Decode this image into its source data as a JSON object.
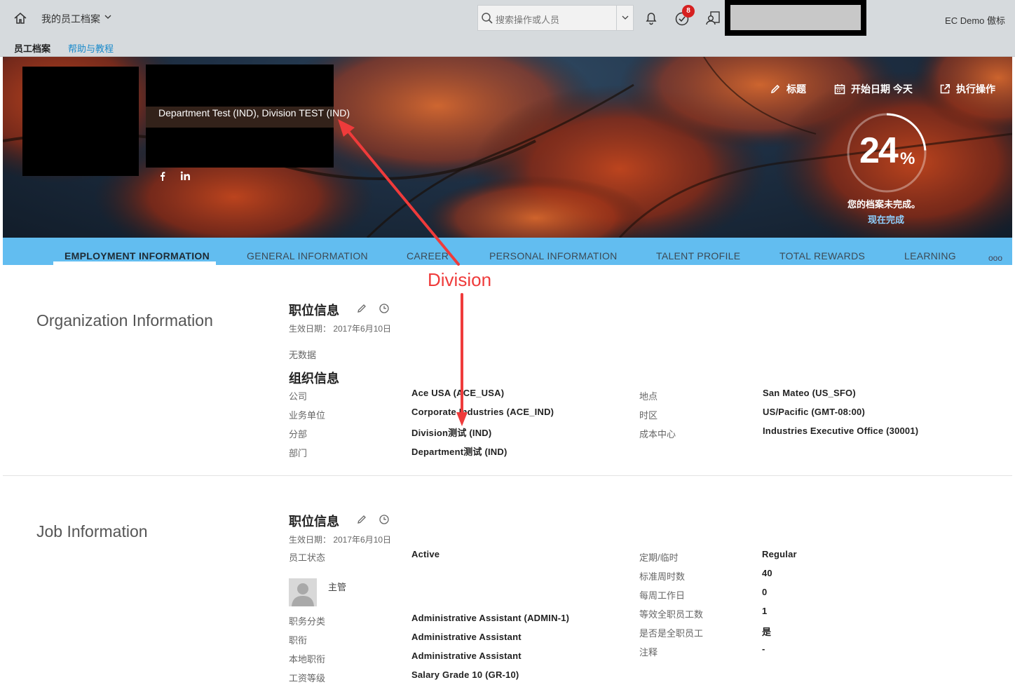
{
  "shell": {
    "app_title": "我的员工档案",
    "search_placeholder": "搜索操作或人员",
    "todo_count": "8",
    "user_name": "EC Demo 傲标",
    "subnav": [
      "员工档案",
      "帮助与教程"
    ]
  },
  "header": {
    "department_line": "Department Test (IND), Division TEST (IND)",
    "actions": [
      "标题",
      "开始日期 今天",
      "执行操作"
    ],
    "profile_completion": {
      "percent": 24,
      "percent_text": "24",
      "percent_sign": "%",
      "caption": "您的档案未完成。",
      "link": "现在完成"
    }
  },
  "tabs": [
    "EMPLOYMENT INFORMATION",
    "GENERAL INFORMATION",
    "CAREER",
    "PERSONAL INFORMATION",
    "TALENT PROFILE",
    "TOTAL REWARDS",
    "LEARNING"
  ],
  "tabs_more": "ooo",
  "org_section": {
    "title": "Organization Information",
    "position_block": {
      "title": "职位信息",
      "effective": "生效日期： 2017年6月10日",
      "nodata": "无数据"
    },
    "org_block": {
      "title": "组织信息",
      "left_fields": [
        {
          "label": "公司",
          "value": "Ace USA (ACE_USA)"
        },
        {
          "label": "业务单位",
          "value": "Corporate Industries (ACE_IND)"
        },
        {
          "label": "分部",
          "value": "Division测试 (IND)"
        },
        {
          "label": "部门",
          "value": "Department测试 (IND)"
        }
      ],
      "right_fields": [
        {
          "label": "地点",
          "value": "San Mateo (US_SFO)"
        },
        {
          "label": "时区",
          "value": "US/Pacific (GMT-08:00)"
        },
        {
          "label": "成本中心",
          "value": "Industries Executive Office (30001)"
        }
      ]
    }
  },
  "job_section": {
    "title": "Job Information",
    "block_title": "职位信息",
    "effective": "生效日期： 2017年6月10日",
    "status_label": "员工状态",
    "status_value": "Active",
    "manager_label": "主管",
    "left_fields": [
      {
        "label": "职务分类",
        "value": "Administrative Assistant (ADMIN-1)"
      },
      {
        "label": "职衔",
        "value": "Administrative Assistant"
      },
      {
        "label": "本地职衔",
        "value": "Administrative Assistant"
      },
      {
        "label": "工资等级",
        "value": "Salary Grade 10 (GR-10)"
      }
    ],
    "right_fields": [
      {
        "label": "定期/临时",
        "value": "Regular"
      },
      {
        "label": "标准周时数",
        "value": "40"
      },
      {
        "label": "每周工作日",
        "value": "0"
      },
      {
        "label": "等效全职员工数",
        "value": "1"
      },
      {
        "label": "是否是全职员工",
        "value": "是"
      },
      {
        "label": "注释",
        "value": "-"
      }
    ]
  },
  "annotation": {
    "label": "Division",
    "color": "#ef3b3b"
  }
}
